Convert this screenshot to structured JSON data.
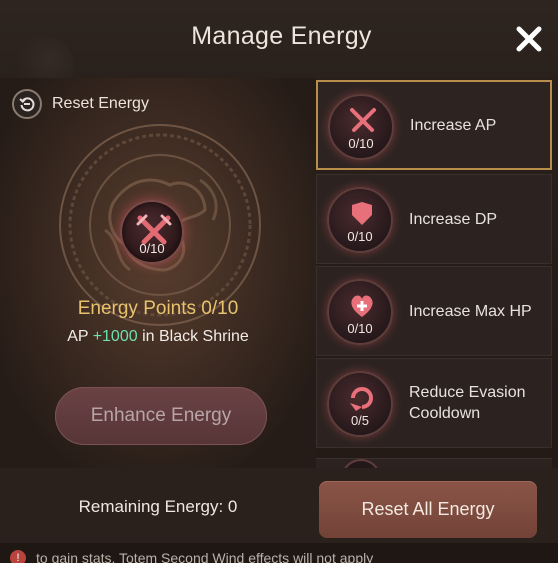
{
  "header": {
    "title": "Manage Energy",
    "close_icon": "close-icon"
  },
  "left": {
    "reset_label": "Reset Energy",
    "reset_icon": "reset-icon",
    "core_level": "0/10",
    "energy_points": "Energy Points 0/10",
    "effect_prefix": "AP ",
    "effect_value": "+1000",
    "effect_suffix": " in Black Shrine",
    "enhance_label": "Enhance Energy"
  },
  "list": {
    "items": [
      {
        "name": "Increase AP",
        "level": "0/10",
        "icon": "swords-icon",
        "selected": true
      },
      {
        "name": "Increase DP",
        "level": "0/10",
        "icon": "armor-icon",
        "selected": false
      },
      {
        "name": "Increase Max HP",
        "level": "0/10",
        "icon": "heart-icon",
        "selected": false
      },
      {
        "name": "Reduce Evasion Cooldown",
        "level": "0/5",
        "icon": "evasion-icon",
        "selected": false
      }
    ]
  },
  "footer": {
    "remaining": "Remaining Energy: 0",
    "reset_all_label": "Reset All Energy"
  },
  "note": {
    "text": "to gain stats. Totem Second Wind effects will not apply"
  },
  "colors": {
    "accent_gold": "#e8c36e",
    "positive_green": "#6ee0b0",
    "selected_border": "#b88e4c",
    "reset_button": "#8a5548"
  }
}
